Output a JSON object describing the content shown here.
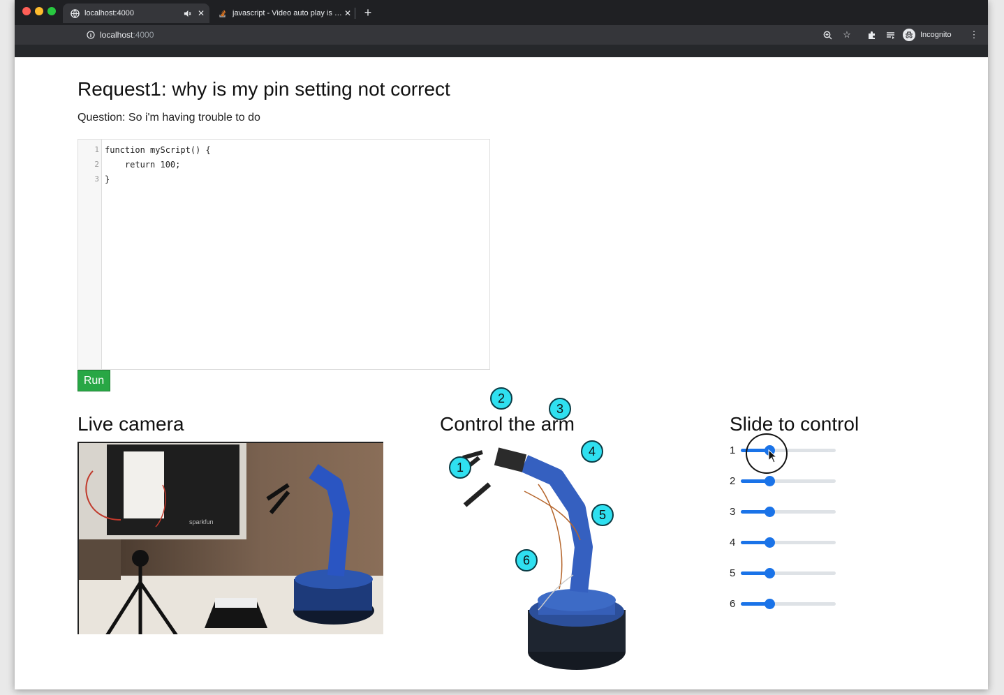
{
  "browser": {
    "tabs": [
      {
        "title": "localhost:4000",
        "active": true
      },
      {
        "title": "javascript - Video auto play is …",
        "active": false
      }
    ],
    "url_host": "localhost",
    "url_port": ":4000",
    "profile_label": "Incognito",
    "icons": [
      "globe-icon",
      "audio-muted-icon",
      "close-icon",
      "new-tab-icon",
      "back-icon",
      "forward-icon",
      "reload-icon",
      "info-icon",
      "zoom-icon",
      "star-icon",
      "extensions-icon",
      "reading-list-icon",
      "profile-icon",
      "menu-icon"
    ]
  },
  "page": {
    "title": "Request1: why is my pin setting not correct",
    "question": "Question: So i'm having trouble to do",
    "editor": {
      "lines": [
        {
          "num": "1",
          "text": "function myScript() {"
        },
        {
          "num": "2",
          "text": "    return 100;"
        },
        {
          "num": "3",
          "text": "}"
        }
      ]
    },
    "run_label": "Run",
    "camera_heading": "Live camera",
    "arm_heading": "Control the arm",
    "slider_heading": "Slide to control",
    "joint_labels": [
      "1",
      "2",
      "3",
      "4",
      "5",
      "6"
    ],
    "sliders": [
      {
        "label": "1",
        "value": 0.3
      },
      {
        "label": "2",
        "value": 0.3
      },
      {
        "label": "3",
        "value": 0.3
      },
      {
        "label": "4",
        "value": 0.3
      },
      {
        "label": "5",
        "value": 0.3
      },
      {
        "label": "6",
        "value": 0.3
      }
    ],
    "colors": {
      "run": "#28a745",
      "slider": "#1a73e8",
      "joint_marker": "#2fe0f0"
    }
  }
}
